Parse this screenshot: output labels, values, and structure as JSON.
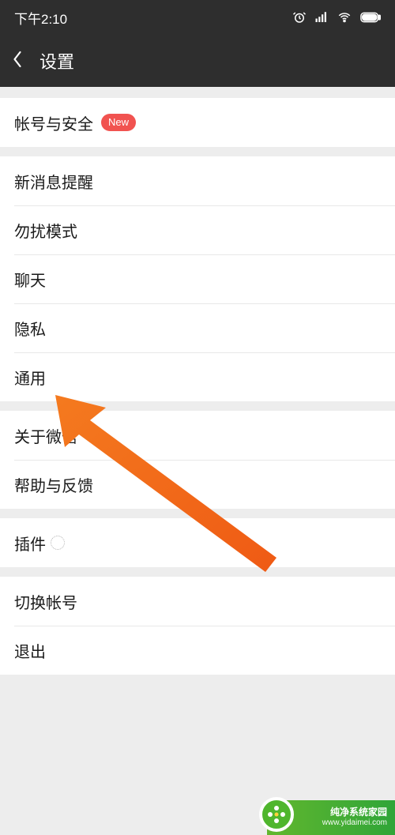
{
  "status": {
    "time": "下午2:10"
  },
  "header": {
    "title": "设置"
  },
  "groups": [
    {
      "items": [
        {
          "label": "帐号与安全",
          "badge": "New"
        }
      ]
    },
    {
      "items": [
        {
          "label": "新消息提醒"
        },
        {
          "label": "勿扰模式"
        },
        {
          "label": "聊天"
        },
        {
          "label": "隐私"
        },
        {
          "label": "通用"
        }
      ]
    },
    {
      "items": [
        {
          "label": "关于微信"
        },
        {
          "label": "帮助与反馈"
        }
      ]
    },
    {
      "items": [
        {
          "label": "插件"
        }
      ]
    },
    {
      "items": [
        {
          "label": "切换帐号"
        },
        {
          "label": "退出"
        }
      ]
    }
  ],
  "watermark": {
    "line1": "纯净系统家园",
    "line2": "www.yidaimei.com"
  }
}
